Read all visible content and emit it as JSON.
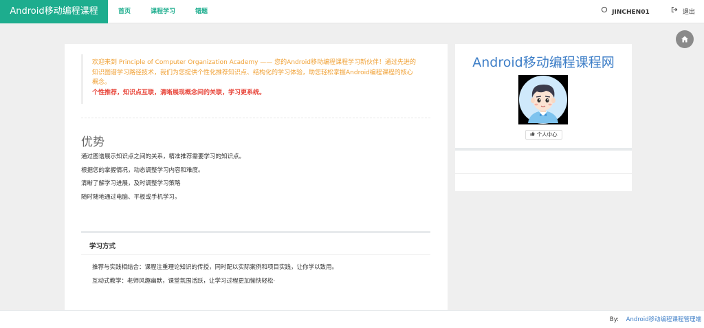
{
  "navbar": {
    "brand": "Android移动编程课程",
    "links": [
      "首页",
      "课程学习",
      "错题"
    ],
    "user": "JINCHEN01",
    "logout": "退出"
  },
  "welcome": {
    "text": "欢迎来到 Principle of Computer Organization Academy —— 您的Android移动编程课程学习新伙伴！通过先进的知识图谱学习路径技术，我们为您提供个性化推荐知识点、结构化的学习体验，助您轻松掌握Android编程课程的核心概念。",
    "strong": "个性推荐，知识点互联，清晰展现概念间的关联，学习更系统。"
  },
  "advantages": {
    "title": "优势",
    "items": [
      "通过图谱展示知识点之间的关系，精准推荐需要学习的知识点。",
      "根据您的掌握情况，动态调整学习内容和难度。",
      "清晰了解学习进展，及时调整学习策略",
      "随时随地通过电脑、平板或手机学习。"
    ]
  },
  "method": {
    "title": "学习方式",
    "items": [
      "推荐与实践相结合：课程注重理论知识的传授，同时配以实际案例和项目实践，让你学以致用。",
      "互动式教学：老师风趣幽默，课堂氛围活跃，让学习过程更加愉快轻松·"
    ]
  },
  "profile": {
    "site_title": "Android移动编程课程网",
    "center_button": "个人中心"
  },
  "footer": {
    "by": "By:",
    "link": "Android移动编程课程管理端"
  },
  "colors": {
    "brand": "#1dad8e",
    "welcome_text": "#f0a136",
    "highlight": "#e8473c",
    "link_blue": "#3d7ec7"
  }
}
